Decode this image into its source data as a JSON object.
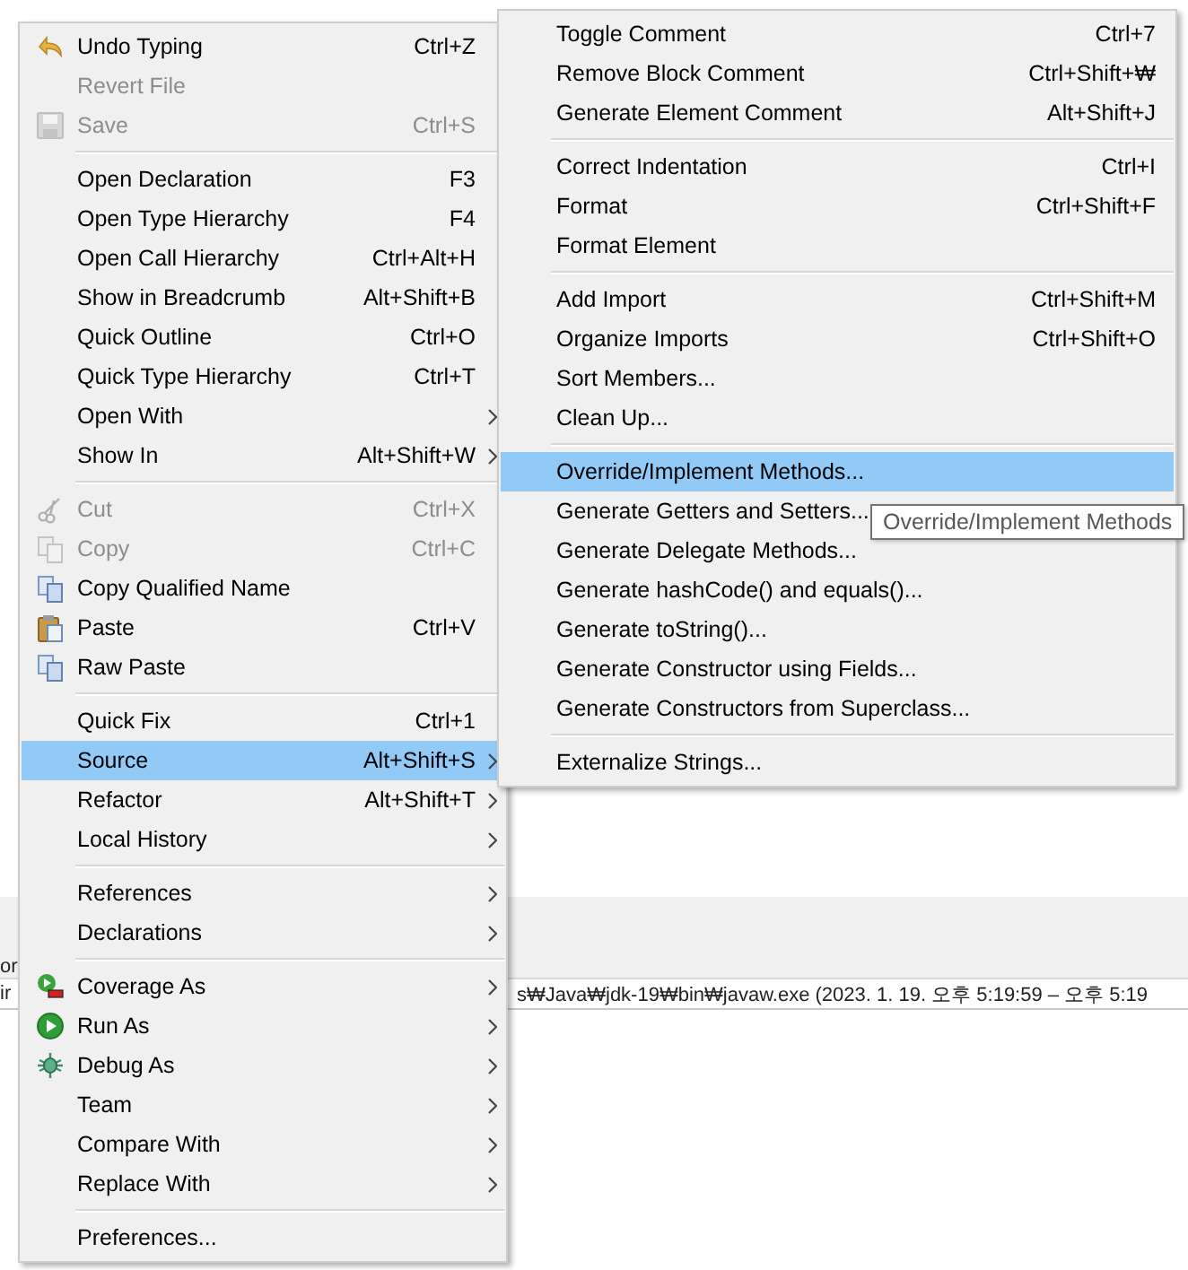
{
  "background": {
    "edge_texts": [
      "or",
      "ir"
    ],
    "console_line": "s₩Java₩jdk-19₩bin₩javaw.exe  (2023. 1. 19. 오후 5:19:59 – 오후 5:19"
  },
  "context_menu": {
    "items": [
      {
        "kind": "undo",
        "label": "Undo Typing",
        "shortcut": "Ctrl+Z",
        "disabled": false,
        "selected": false
      },
      {
        "kind": "item",
        "label": "Revert File",
        "disabled": true,
        "selected": false
      },
      {
        "kind": "save",
        "label": "Save",
        "shortcut": "Ctrl+S",
        "disabled": true,
        "selected": false
      },
      {
        "kind": "separator"
      },
      {
        "kind": "item",
        "label": "Open Declaration",
        "shortcut": "F3",
        "disabled": false,
        "selected": false
      },
      {
        "kind": "item",
        "label": "Open Type Hierarchy",
        "shortcut": "F4",
        "disabled": false,
        "selected": false
      },
      {
        "kind": "item",
        "label": "Open Call Hierarchy",
        "shortcut": "Ctrl+Alt+H",
        "disabled": false,
        "selected": false
      },
      {
        "kind": "item",
        "label": "Show in Breadcrumb",
        "shortcut": "Alt+Shift+B",
        "disabled": false,
        "selected": false
      },
      {
        "kind": "item",
        "label": "Quick Outline",
        "shortcut": "Ctrl+O",
        "disabled": false,
        "selected": false
      },
      {
        "kind": "item",
        "label": "Quick Type Hierarchy",
        "shortcut": "Ctrl+T",
        "disabled": false,
        "selected": false
      },
      {
        "kind": "item",
        "label": "Open With",
        "submenu": true,
        "disabled": false,
        "selected": false
      },
      {
        "kind": "item",
        "label": "Show In",
        "shortcut": "Alt+Shift+W",
        "submenu": true,
        "disabled": false,
        "selected": false
      },
      {
        "kind": "separator"
      },
      {
        "kind": "cut",
        "label": "Cut",
        "shortcut": "Ctrl+X",
        "disabled": true,
        "selected": false
      },
      {
        "kind": "copy",
        "label": "Copy",
        "shortcut": "Ctrl+C",
        "disabled": true,
        "selected": false
      },
      {
        "kind": "copy",
        "label": "Copy Qualified Name",
        "disabled": false,
        "selected": false
      },
      {
        "kind": "paste",
        "label": "Paste",
        "shortcut": "Ctrl+V",
        "disabled": false,
        "selected": false
      },
      {
        "kind": "copy",
        "label": "Raw Paste",
        "disabled": false,
        "selected": false
      },
      {
        "kind": "separator"
      },
      {
        "kind": "item",
        "label": "Quick Fix",
        "shortcut": "Ctrl+1",
        "disabled": false,
        "selected": false
      },
      {
        "kind": "item",
        "label": "Source",
        "shortcut": "Alt+Shift+S",
        "submenu": true,
        "disabled": false,
        "selected": true
      },
      {
        "kind": "item",
        "label": "Refactor",
        "shortcut": "Alt+Shift+T",
        "submenu": true,
        "disabled": false,
        "selected": false
      },
      {
        "kind": "item",
        "label": "Local History",
        "submenu": true,
        "disabled": false,
        "selected": false
      },
      {
        "kind": "separator"
      },
      {
        "kind": "item",
        "label": "References",
        "submenu": true,
        "disabled": false,
        "selected": false
      },
      {
        "kind": "item",
        "label": "Declarations",
        "submenu": true,
        "disabled": false,
        "selected": false
      },
      {
        "kind": "separator"
      },
      {
        "kind": "coverage",
        "label": "Coverage As",
        "submenu": true,
        "disabled": false,
        "selected": false
      },
      {
        "kind": "run",
        "label": "Run As",
        "submenu": true,
        "disabled": false,
        "selected": false
      },
      {
        "kind": "debug",
        "label": "Debug As",
        "submenu": true,
        "disabled": false,
        "selected": false
      },
      {
        "kind": "item",
        "label": "Team",
        "submenu": true,
        "disabled": false,
        "selected": false
      },
      {
        "kind": "item",
        "label": "Compare With",
        "submenu": true,
        "disabled": false,
        "selected": false
      },
      {
        "kind": "item",
        "label": "Replace With",
        "submenu": true,
        "disabled": false,
        "selected": false
      },
      {
        "kind": "separator"
      },
      {
        "kind": "item",
        "label": "Preferences...",
        "disabled": false,
        "selected": false
      }
    ]
  },
  "source_submenu": {
    "items": [
      {
        "kind": "item",
        "label": "Toggle Comment",
        "shortcut": "Ctrl+7",
        "selected": false
      },
      {
        "kind": "item",
        "label": "Remove Block Comment",
        "shortcut": "Ctrl+Shift+₩",
        "selected": false
      },
      {
        "kind": "item",
        "label": "Generate Element Comment",
        "shortcut": "Alt+Shift+J",
        "selected": false
      },
      {
        "kind": "separator"
      },
      {
        "kind": "item",
        "label": "Correct Indentation",
        "shortcut": "Ctrl+I",
        "selected": false
      },
      {
        "kind": "item",
        "label": "Format",
        "shortcut": "Ctrl+Shift+F",
        "selected": false
      },
      {
        "kind": "item",
        "label": "Format Element",
        "selected": false
      },
      {
        "kind": "separator"
      },
      {
        "kind": "item",
        "label": "Add Import",
        "shortcut": "Ctrl+Shift+M",
        "selected": false
      },
      {
        "kind": "item",
        "label": "Organize Imports",
        "shortcut": "Ctrl+Shift+O",
        "selected": false
      },
      {
        "kind": "item",
        "label": "Sort Members...",
        "selected": false
      },
      {
        "kind": "item",
        "label": "Clean Up...",
        "selected": false
      },
      {
        "kind": "separator"
      },
      {
        "kind": "item",
        "label": "Override/Implement Methods...",
        "selected": true
      },
      {
        "kind": "item",
        "label": "Generate Getters and Setters...",
        "selected": false
      },
      {
        "kind": "item",
        "label": "Generate Delegate Methods...",
        "selected": false
      },
      {
        "kind": "item",
        "label": "Generate hashCode() and equals()...",
        "selected": false
      },
      {
        "kind": "item",
        "label": "Generate toString()...",
        "selected": false
      },
      {
        "kind": "item",
        "label": "Generate Constructor using Fields...",
        "selected": false
      },
      {
        "kind": "item",
        "label": "Generate Constructors from Superclass...",
        "selected": false
      },
      {
        "kind": "separator"
      },
      {
        "kind": "item",
        "label": "Externalize Strings...",
        "selected": false
      }
    ]
  },
  "tooltip": "Override/Implement Methods"
}
